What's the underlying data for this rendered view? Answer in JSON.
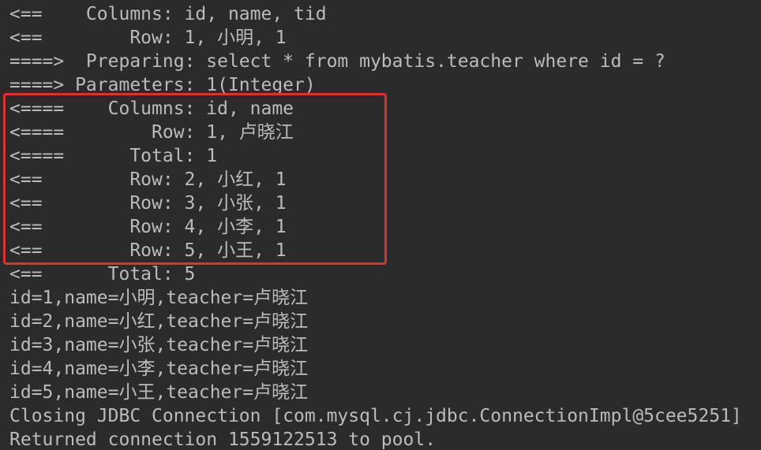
{
  "console": {
    "lines": [
      "<==    Columns: id, name, tid",
      "<==        Row: 1, 小明, 1",
      "====>  Preparing: select * from mybatis.teacher where id = ?",
      "====> Parameters: 1(Integer)",
      "<====    Columns: id, name",
      "<====        Row: 1, 卢晓江",
      "<====      Total: 1",
      "<==        Row: 2, 小红, 1",
      "<==        Row: 3, 小张, 1",
      "<==        Row: 4, 小李, 1",
      "<==        Row: 5, 小王, 1",
      "<==      Total: 5",
      "id=1,name=小明,teacher=卢晓江",
      "id=2,name=小红,teacher=卢晓江",
      "id=3,name=小张,teacher=卢晓江",
      "id=4,name=小李,teacher=卢晓江",
      "id=5,name=小王,teacher=卢晓江",
      "Closing JDBC Connection [com.mysql.cj.jdbc.ConnectionImpl@5cee5251]",
      "Returned connection 1559122513 to pool."
    ]
  },
  "colors": {
    "background": "#2b2b2b",
    "text": "#bbbbbb",
    "highlight_border": "#e0312f"
  }
}
